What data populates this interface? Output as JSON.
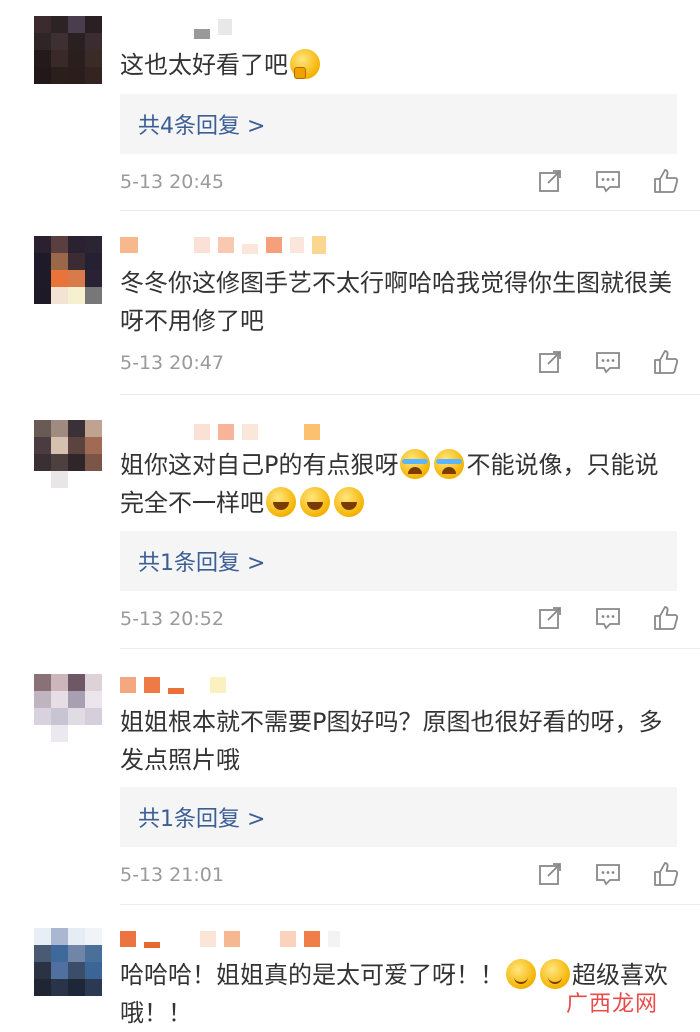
{
  "comments": [
    {
      "text": "这也太好看了吧",
      "emoji": [
        "think"
      ],
      "replies_label": "共4条回复 >",
      "time": "5-13 20:45"
    },
    {
      "text": "冬冬你这修图手艺不太行啊哈哈我觉得你生图就很美呀不用修了吧",
      "emoji": [],
      "time": "5-13 20:47"
    },
    {
      "text_a": "姐你这对自己P的有点狠呀",
      "text_b": "不能说像，只能说完全不一样吧",
      "emoji": [
        "cry",
        "cry",
        "laugh",
        "laugh",
        "laugh"
      ],
      "replies_label": "共1条回复 >",
      "time": "5-13 20:52"
    },
    {
      "text": "姐姐根本就不需要P图好吗？原图也很好看的呀，多发点照片哦",
      "emoji": [],
      "replies_label": "共1条回复 >",
      "time": "5-13 21:01"
    },
    {
      "text_a": "哈哈哈！姐姐真的是太可爱了呀！！",
      "text_b": "超级喜欢哦！！",
      "emoji": [
        "smile",
        "smile"
      ]
    }
  ],
  "icons": [
    "share-icon",
    "comment-icon",
    "like-icon"
  ],
  "watermark": {
    "text": "广西龙网"
  },
  "colors": {
    "reply_link": "#3a5e95",
    "reply_bg": "#f5f5f5",
    "meta": "#9a9a9a"
  }
}
